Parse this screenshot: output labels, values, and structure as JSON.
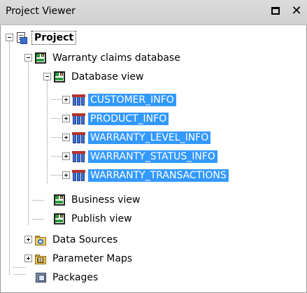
{
  "window": {
    "title": "Project Viewer",
    "maximize_icon": "maximize-icon",
    "close_glyph": "✕",
    "close_icon": "close-icon"
  },
  "tree": {
    "project": {
      "label": "Project",
      "icon": "project-icon",
      "expanded": true
    },
    "model": {
      "label": "Warranty claims database",
      "icon": "model-icon",
      "expanded": true
    },
    "database_view": {
      "label": "Database view",
      "icon": "namespace-icon",
      "expanded": true
    },
    "query_subjects": [
      {
        "label": "CUSTOMER_INFO",
        "icon": "query-subject-icon",
        "selected": true
      },
      {
        "label": "PRODUCT_INFO",
        "icon": "query-subject-icon",
        "selected": true
      },
      {
        "label": "WARRANTY_LEVEL_INFO",
        "icon": "query-subject-icon",
        "selected": true
      },
      {
        "label": "WARRANTY_STATUS_INFO",
        "icon": "query-subject-icon",
        "selected": true
      },
      {
        "label": "WARRANTY_TRANSACTIONS",
        "icon": "query-subject-icon",
        "selected": true
      }
    ],
    "business_view": {
      "label": "Business view",
      "icon": "namespace-icon"
    },
    "publish_view": {
      "label": "Publish view",
      "icon": "namespace-icon"
    },
    "data_sources": {
      "label": "Data Sources",
      "icon": "data-sources-folder-icon",
      "expanded": false
    },
    "parameter_maps": {
      "label": "Parameter Maps",
      "icon": "parameter-maps-folder-icon",
      "expanded": false
    },
    "packages": {
      "label": "Packages",
      "icon": "packages-icon"
    }
  },
  "colors": {
    "selection": "#3399ff",
    "titlebar": "#d4d4d4"
  }
}
